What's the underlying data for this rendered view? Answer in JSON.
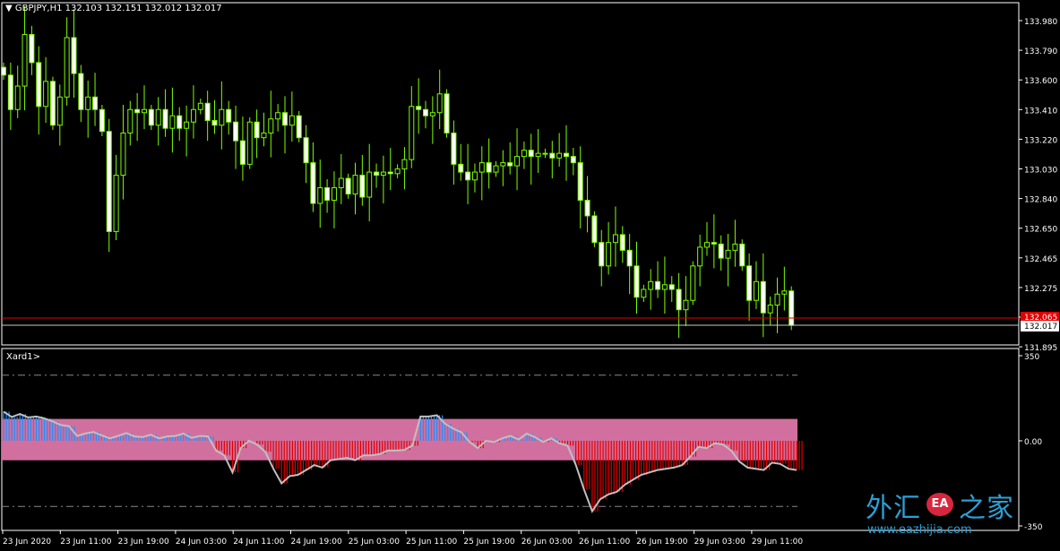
{
  "header": {
    "symbol": "GBPJPY,H1",
    "ohlc": "132.103 132.151 132.012 132.017"
  },
  "price_axis": {
    "labels": [
      "133.980",
      "133.790",
      "133.600",
      "133.410",
      "133.220",
      "133.030",
      "132.840",
      "132.650",
      "132.465",
      "132.275",
      "132.085",
      "131.895"
    ],
    "alert_price_label": "132.065",
    "current_price_label": "132.017"
  },
  "subwindow": {
    "title": "Xard1>",
    "axis_labels": [
      "350",
      "0.00",
      "-350"
    ]
  },
  "time_axis": {
    "labels": [
      "23 Jun 2020",
      "23 Jun 11:00",
      "23 Jun 19:00",
      "24 Jun 03:00",
      "24 Jun 11:00",
      "24 Jun 19:00",
      "25 Jun 03:00",
      "25 Jun 11:00",
      "25 Jun 19:00",
      "26 Jun 03:00",
      "26 Jun 11:00",
      "26 Jun 19:00",
      "29 Jun 03:00",
      "29 Jun 11:00"
    ]
  },
  "watermark": {
    "chinese": "外汇",
    "logo": "EA",
    "chinese2": "之家",
    "url": "www.eazhijia.com"
  },
  "colors": {
    "background": "#000000",
    "candle": "#7CFC00",
    "bull_fill": "#000000",
    "bear_fill": "#FFFFFF",
    "alert_line": "#E00000",
    "band": "#D1709F",
    "hist_pos": "#1E90FF",
    "hist_neg": "#E00000",
    "osc_line": "#C0C0C0"
  },
  "chart_data": {
    "type": "candlestick",
    "symbol": "GBPJPY",
    "timeframe": "H1",
    "series": [
      {
        "name": "price",
        "close": [
          133.62,
          133.4,
          133.55,
          133.88,
          133.7,
          133.42,
          133.58,
          133.3,
          133.48,
          133.86,
          133.63,
          133.4,
          133.48,
          133.4,
          133.26,
          132.62,
          132.98,
          133.25,
          133.4,
          133.38,
          133.4,
          133.3,
          133.4,
          133.28,
          133.36,
          133.28,
          133.32,
          133.4,
          133.44,
          133.33,
          133.3,
          133.4,
          133.32,
          133.2,
          133.05,
          133.32,
          133.22,
          133.25,
          133.34,
          133.38,
          133.3,
          133.36,
          133.22,
          133.06,
          132.8,
          132.9,
          132.82,
          132.9,
          132.96,
          132.86,
          132.98,
          132.84,
          133.0,
          132.98,
          133.0,
          132.99,
          133.02,
          133.08,
          133.42,
          133.4,
          133.36,
          133.38,
          133.5,
          133.25,
          133.05,
          133.0,
          132.95,
          133.0,
          133.06,
          133.0,
          133.04,
          133.06,
          133.04,
          133.1,
          133.14,
          133.1,
          133.12,
          133.12,
          133.09,
          133.12,
          133.1,
          133.06,
          132.82,
          132.72,
          132.55,
          132.4,
          132.55,
          132.6,
          132.5,
          132.4,
          132.2,
          132.25,
          132.3,
          132.25,
          132.28,
          132.25,
          132.12,
          132.18,
          132.4,
          132.52,
          132.55,
          132.54,
          132.45,
          132.5,
          132.54,
          132.4,
          132.18,
          132.3,
          132.1,
          132.15,
          132.22,
          132.24,
          132.02
        ]
      },
      {
        "name": "Xard1",
        "values": [
          120,
          98,
          110,
          96,
          100,
          92,
          80,
          65,
          60,
          20,
          30,
          36,
          22,
          10,
          20,
          32,
          18,
          15,
          25,
          10,
          18,
          20,
          30,
          12,
          20,
          18,
          -40,
          -60,
          -130,
          -30,
          0,
          -15,
          -45,
          -115,
          -175,
          -145,
          -140,
          -120,
          -100,
          -110,
          -80,
          -75,
          -70,
          -80,
          -60,
          -60,
          -55,
          -40,
          -40,
          -38,
          -20,
          100,
          100,
          105,
          70,
          50,
          35,
          -5,
          -30,
          0,
          -5,
          10,
          20,
          5,
          30,
          15,
          -5,
          10,
          -10,
          -20,
          -100,
          -200,
          -290,
          -240,
          -220,
          -210,
          -180,
          -160,
          -140,
          -130,
          -120,
          -115,
          -110,
          -100,
          -65,
          -25,
          -30,
          -10,
          -15,
          -40,
          -85,
          -110,
          -115,
          -120,
          -90,
          -95,
          -115,
          -120
        ]
      }
    ],
    "price_range": [
      131.895,
      133.98
    ],
    "oscillator_range": [
      -350,
      350
    ],
    "grid": false
  }
}
